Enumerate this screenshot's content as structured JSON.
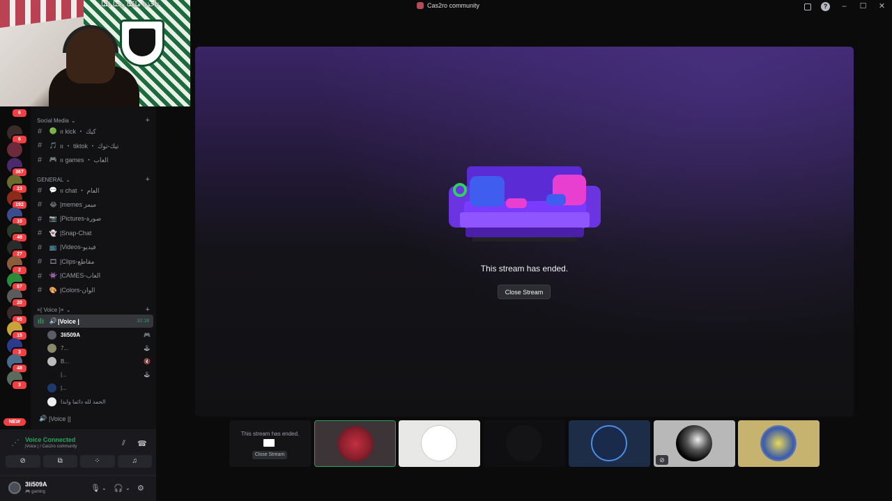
{
  "window": {
    "title": "Cas2ro community"
  },
  "webcam": {
    "overlay_text": "تأخذنا ملكنا وحنا قلبا"
  },
  "servers": [
    {
      "color": "#3b2a2a",
      "badge": "6"
    },
    {
      "color": "#6b2b3b",
      "badge": ""
    },
    {
      "color": "#4b2a6b",
      "badge": "367"
    },
    {
      "color": "#6b6b2b",
      "badge": "23"
    },
    {
      "color": "#8b2b1b",
      "badge": "192"
    },
    {
      "color": "#3b4b8b",
      "badge": "10"
    },
    {
      "color": "#2b3b2b",
      "badge": "48"
    },
    {
      "color": "#2b2b2b",
      "badge": "27"
    },
    {
      "color": "#8b5b3b",
      "badge": "2"
    },
    {
      "color": "#2b8b3b",
      "badge": "57"
    },
    {
      "color": "#5b5b5b",
      "badge": "20"
    },
    {
      "color": "#3b2b2b",
      "badge": "95"
    },
    {
      "color": "#c8a23b",
      "badge": "15"
    },
    {
      "color": "#2b3b8b",
      "badge": "3"
    },
    {
      "color": "#4b6b8b",
      "badge": "48"
    },
    {
      "color": "#5b6b5b",
      "badge": "3"
    }
  ],
  "new_badge": "NEW",
  "categories": {
    "social": "Social Media",
    "general": "GENERAL",
    "voice": "×{ Voice }×"
  },
  "channels": {
    "social": [
      {
        "emoji": "🟢",
        "name": "ıı kick ・ كيك"
      },
      {
        "emoji": "🎵",
        "name": "ıı ・ tiktok ・ تيك-توك"
      },
      {
        "emoji": "🎮",
        "name": "ıı games ・ العاب"
      }
    ],
    "general": [
      {
        "emoji": "💬",
        "name": "ıı chat ・ العام"
      },
      {
        "emoji": "😂",
        "name": "|memes ميمز"
      },
      {
        "emoji": "📷",
        "name": "|Pictures-صورة"
      },
      {
        "emoji": "👻",
        "name": "|Snap-Chat"
      },
      {
        "emoji": "📺",
        "name": "|Videos-فيديو"
      },
      {
        "emoji": "🎞",
        "name": "|Clips-مقاطع"
      },
      {
        "emoji": "👾",
        "name": "|CAMES-العاب"
      },
      {
        "emoji": "🎨",
        "name": "|Colors-الوان"
      }
    ]
  },
  "voice_channel": {
    "name": "|Voice |",
    "timer": "32:18"
  },
  "voice_users": [
    {
      "name": "3li509A",
      "status": "🎮",
      "color": "#5a5d66",
      "bold": true
    },
    {
      "name": "7...",
      "status": "🕹",
      "color": "#8a8a6a",
      "bold": false
    },
    {
      "name": "B...",
      "status": "🔇",
      "color": "#bbbbbb",
      "bold": false
    },
    {
      "name": "|...",
      "status": "🕹",
      "color": "#111111",
      "bold": false
    },
    {
      "name": "|...",
      "status": "",
      "color": "#1d3a6a",
      "bold": false
    },
    {
      "name": "الحمد لله دائما وابدا",
      "status": "",
      "color": "#eeeeee",
      "bold": false
    }
  ],
  "voice_channel_2": {
    "name": "|Voice ||"
  },
  "voice_panel": {
    "status": "Voice Connected",
    "location": "|Voice | / Cas2ro community"
  },
  "user": {
    "name": "3li509A",
    "status": "🎮 gaming"
  },
  "stage": {
    "ended_text": "This stream has ended.",
    "close_label": "Close Stream"
  },
  "tiles": {
    "first_message": "This stream has ended.",
    "first_close": "Close Stream"
  }
}
